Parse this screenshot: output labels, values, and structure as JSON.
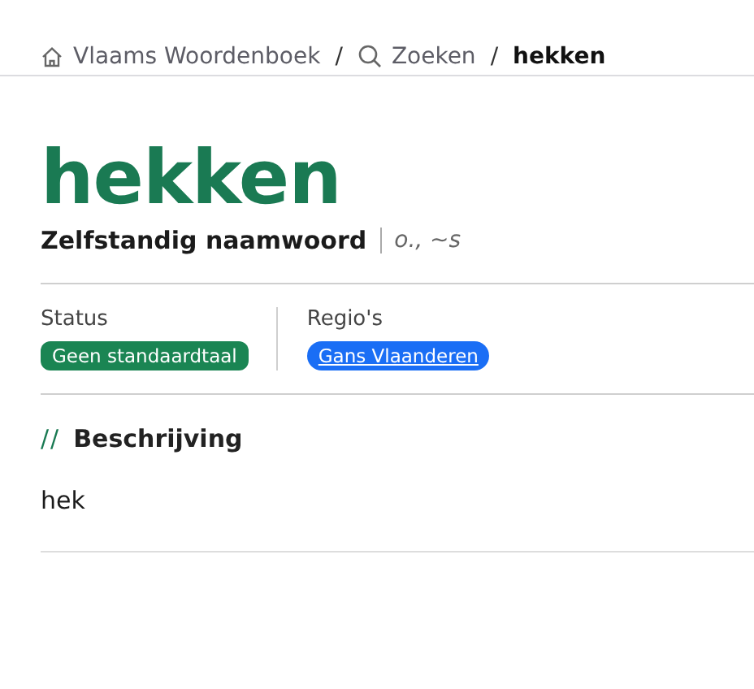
{
  "breadcrumb": [
    {
      "kind": "home",
      "label": "Vlaams Woordenboek"
    },
    {
      "kind": "search",
      "label": "Zoeken"
    },
    {
      "kind": "current",
      "label": "hekken"
    }
  ],
  "breadcrumb_separator": "/",
  "entry": {
    "headword": "hekken",
    "part_of_speech": "Zelfstandig naamwoord",
    "grammar": "o., ~s"
  },
  "facets": [
    {
      "label": "Status",
      "tags": [
        {
          "text": "Geen standaardtaal",
          "kind": "status",
          "color": "#1a8553"
        }
      ]
    },
    {
      "label": "Regio's",
      "tags": [
        {
          "text": "Gans Vlaanderen",
          "kind": "link",
          "color": "#1a6ef5"
        }
      ]
    }
  ],
  "section": {
    "marker": "//",
    "title": "Beschrijving",
    "body": "hek"
  }
}
